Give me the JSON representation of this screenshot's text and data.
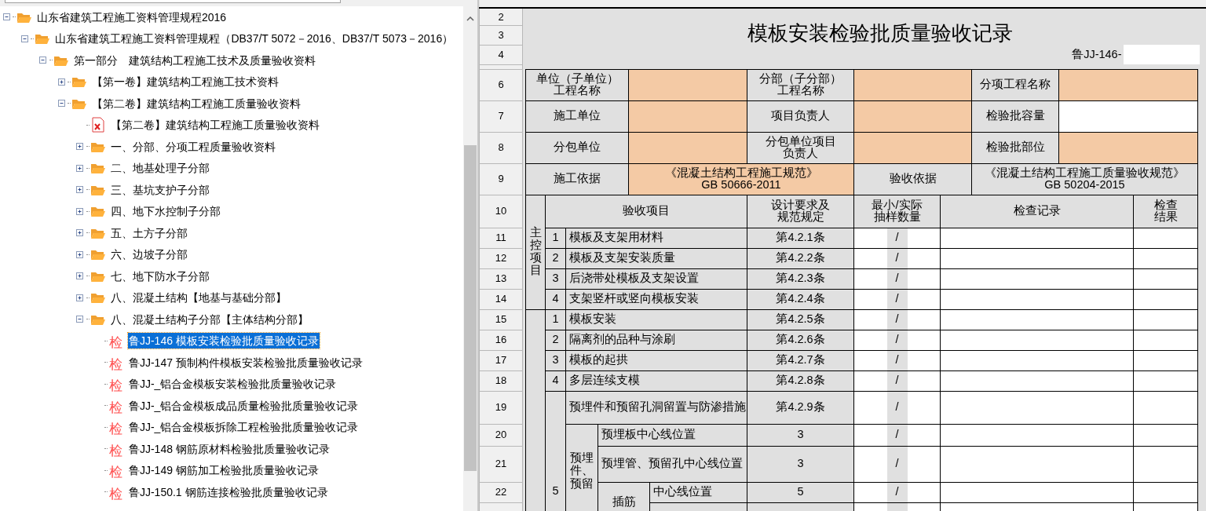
{
  "tree": [
    {
      "kind": "folder",
      "label": "山东省建筑工程施工资料管理规程2016",
      "expanded": true,
      "selected": false,
      "children": [
        {
          "kind": "folder",
          "label": "山东省建筑工程施工资料管理规程（DB37/T 5072－2016、DB37/T 5073－2016）",
          "expanded": true,
          "selected": false,
          "children": [
            {
              "kind": "folder",
              "label": "第一部分　建筑结构工程施工技术及质量验收资料",
              "expanded": true,
              "selected": false,
              "children": [
                {
                  "kind": "folder",
                  "label": "【第一卷】建筑结构工程施工技术资料",
                  "expanded": false,
                  "selected": false
                },
                {
                  "kind": "folder",
                  "label": "【第二卷】建筑结构工程施工质量验收资料",
                  "expanded": true,
                  "selected": false,
                  "children": [
                    {
                      "kind": "pdf",
                      "label": "【第二卷】建筑结构工程施工质量验收资料",
                      "selected": false
                    },
                    {
                      "kind": "folder",
                      "label": "一、分部、分项工程质量验收资料",
                      "expanded": false,
                      "selected": false
                    },
                    {
                      "kind": "folder",
                      "label": "二、地基处理子分部",
                      "expanded": false,
                      "selected": false
                    },
                    {
                      "kind": "folder",
                      "label": "三、基坑支护子分部",
                      "expanded": false,
                      "selected": false
                    },
                    {
                      "kind": "folder",
                      "label": "四、地下水控制子分部",
                      "expanded": false,
                      "selected": false
                    },
                    {
                      "kind": "folder",
                      "label": "五、土方子分部",
                      "expanded": false,
                      "selected": false
                    },
                    {
                      "kind": "folder",
                      "label": "六、边坡子分部",
                      "expanded": false,
                      "selected": false
                    },
                    {
                      "kind": "folder",
                      "label": "七、地下防水子分部",
                      "expanded": false,
                      "selected": false
                    },
                    {
                      "kind": "folder",
                      "label": "八、混凝土结构【地基与基础分部】",
                      "expanded": false,
                      "selected": false
                    },
                    {
                      "kind": "folder",
                      "label": "八、混凝土结构子分部【主体结构分部】",
                      "expanded": true,
                      "selected": false,
                      "children": [
                        {
                          "kind": "form",
                          "badge": "检",
                          "label": "鲁JJ-146 模板安装检验批质量验收记录",
                          "selected": true
                        },
                        {
                          "kind": "form",
                          "badge": "检",
                          "label": "鲁JJ-147 预制构件模板安装检验批质量验收记录",
                          "selected": false
                        },
                        {
                          "kind": "form",
                          "badge": "检",
                          "label": "鲁JJ-_铝合金模板安装检验批质量验收记录",
                          "selected": false
                        },
                        {
                          "kind": "form",
                          "badge": "检",
                          "label": "鲁JJ-_铝合金模板成品质量检验批质量验收记录",
                          "selected": false
                        },
                        {
                          "kind": "form",
                          "badge": "检",
                          "label": "鲁JJ-_铝合金模板拆除工程检验批质量验收记录",
                          "selected": false
                        },
                        {
                          "kind": "form",
                          "badge": "检",
                          "label": "鲁JJ-148 钢筋原材料检验批质量验收记录",
                          "selected": false
                        },
                        {
                          "kind": "form",
                          "badge": "检",
                          "label": "鲁JJ-149 钢筋加工检验批质量验收记录",
                          "selected": false
                        },
                        {
                          "kind": "form",
                          "badge": "检",
                          "label": "鲁JJ-150.1 钢筋连接检验批质量验收记录",
                          "selected": false
                        }
                      ]
                    }
                  ]
                }
              ]
            }
          ]
        }
      ]
    }
  ],
  "sheet": {
    "row_numbers": [
      "2",
      "3",
      "4",
      "6",
      "7",
      "8",
      "9",
      "10",
      "11",
      "12",
      "13",
      "14",
      "15",
      "16",
      "17",
      "18",
      "19",
      "20",
      "21",
      "22"
    ],
    "title": "模板安装检验批质量验收记录",
    "code_label": "鲁JJ-146-",
    "info_rows": [
      [
        {
          "kind": "label",
          "text": [
            "单位（子单位）",
            "工程名称"
          ]
        },
        {
          "kind": "required"
        },
        {
          "kind": "label",
          "text": [
            "分部（子分部）",
            "工程名称"
          ]
        },
        {
          "kind": "required"
        },
        {
          "kind": "label",
          "text": "分项工程名称"
        },
        {
          "kind": "required"
        }
      ],
      [
        {
          "kind": "label",
          "text": "施工单位"
        },
        {
          "kind": "required"
        },
        {
          "kind": "label",
          "text": "项目负责人"
        },
        {
          "kind": "required"
        },
        {
          "kind": "label",
          "text": "检验批容量"
        },
        {
          "kind": "blank"
        }
      ],
      [
        {
          "kind": "label",
          "text": "分包单位"
        },
        {
          "kind": "required"
        },
        {
          "kind": "label",
          "text": [
            "分包单位项目",
            "负责人"
          ]
        },
        {
          "kind": "required"
        },
        {
          "kind": "label",
          "text": "检验批部位"
        },
        {
          "kind": "required"
        }
      ],
      [
        {
          "kind": "label",
          "text": "施工依据"
        },
        {
          "kind": "required",
          "text": "《混凝土结构工程施工规范》\nGB 50666-2011"
        },
        {
          "kind": "label",
          "text": "验收依据"
        },
        {
          "kind": "fixed",
          "text": "《混凝土结构工程施工质量验收规范》\nGB 50204-2015"
        }
      ]
    ],
    "header": [
      [
        "验收项目"
      ],
      [
        "设计要求及",
        "规范规定"
      ],
      [
        "最小/实际",
        "抽样数量"
      ],
      [
        "检查记录"
      ],
      [
        "检查",
        "结果"
      ]
    ],
    "main_control": {
      "label": "主控项目",
      "items": [
        {
          "no": "1",
          "name": "模板及支架用材料",
          "spec": "第4.2.1条",
          "sample": "/"
        },
        {
          "no": "2",
          "name": "模板及支架安装质量",
          "spec": "第4.2.2条",
          "sample": "/"
        },
        {
          "no": "3",
          "name": "后浇带处模板及支架设置",
          "spec": "第4.2.3条",
          "sample": "/"
        },
        {
          "no": "4",
          "name": "支架竖杆或竖向模板安装",
          "spec": "第4.2.4条",
          "sample": "/"
        }
      ]
    },
    "general": {
      "items": [
        {
          "no": "1",
          "name": "模板安装",
          "spec": "第4.2.5条",
          "sample": "/"
        },
        {
          "no": "2",
          "name": "隔离剂的品种与涂刷",
          "spec": "第4.2.6条",
          "sample": "/"
        },
        {
          "no": "3",
          "name": "模板的起拱",
          "spec": "第4.2.7条",
          "sample": "/"
        },
        {
          "no": "4",
          "name": "多层连续支模",
          "spec": "第4.2.8条",
          "sample": "/"
        }
      ],
      "composite": {
        "no": "5",
        "name": "预埋件和预留孔洞留置与防渗措施",
        "spec": "第4.2.9条",
        "sample": "/",
        "sub_label": "预埋件、预留",
        "subs": [
          {
            "name": "预埋板中心线位置",
            "spec": "3",
            "sample": "/"
          },
          {
            "name": "预埋管、预留孔中心线位置",
            "spec": "3",
            "sample": "/"
          },
          {
            "group": "插筋",
            "name": "中心线位置",
            "spec": "5",
            "sample": "/"
          }
        ]
      }
    }
  }
}
